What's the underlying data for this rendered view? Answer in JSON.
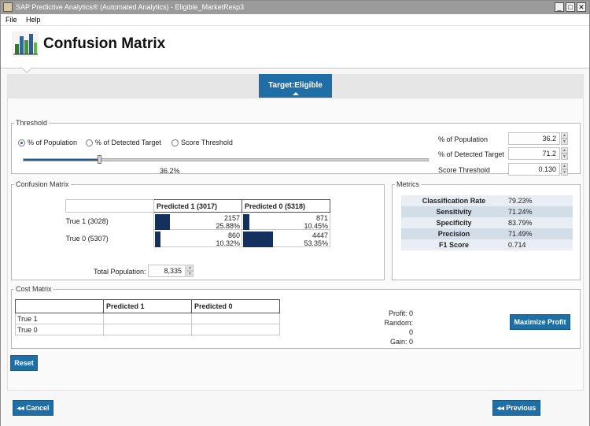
{
  "window": {
    "title": "SAP Predictive Analytics® (Automated Analytics) - Eligible_MarketResp3"
  },
  "menu": {
    "file": "File",
    "help": "Help"
  },
  "header": {
    "title": "Confusion Matrix"
  },
  "tab": {
    "label": "Target:Eligible"
  },
  "threshold": {
    "legend": "Threshold",
    "radios": [
      "% of Population",
      "% of Detected Target",
      "Score Threshold"
    ],
    "selected": 0,
    "slider": {
      "value_label": "36.2%",
      "fraction": 0.362
    },
    "fields": [
      {
        "label": "% of Population",
        "value": "36.2"
      },
      {
        "label": "% of Detected Target",
        "value": "71.2"
      },
      {
        "label": "Score Threshold",
        "value": "0.130"
      }
    ]
  },
  "confusion": {
    "legend": "Confusion Matrix",
    "col_headers": [
      "Predicted 1  (3017)",
      "Predicted 0  (5318)"
    ],
    "rows": [
      {
        "label": "True 1  (3028)",
        "cells": [
          {
            "count": "2157",
            "pct": "25.88%",
            "fraction": 0.2588
          },
          {
            "count": "871",
            "pct": "10.45%",
            "fraction": 0.1045
          }
        ]
      },
      {
        "label": "True 0  (5307)",
        "cells": [
          {
            "count": "860",
            "pct": "10.32%",
            "fraction": 0.1032
          },
          {
            "count": "4447",
            "pct": "53.35%",
            "fraction": 0.5335
          }
        ]
      }
    ],
    "total_label": "Total Population:",
    "total_value": "8,335"
  },
  "metrics": {
    "legend": "Metrics",
    "items": [
      {
        "name": "Classification Rate",
        "value": "79.23%"
      },
      {
        "name": "Sensitivity",
        "value": "71.24%"
      },
      {
        "name": "Specificity",
        "value": "83.79%"
      },
      {
        "name": "Precision",
        "value": "71.49%"
      },
      {
        "name": "F1 Score",
        "value": "0.714"
      }
    ]
  },
  "cost": {
    "legend": "Cost Matrix",
    "col_headers": [
      "Predicted 1",
      "Predicted 0"
    ],
    "rows": [
      "True 1",
      "True 0"
    ],
    "profit": "Profit: 0",
    "random": "Random: 0",
    "gain": "Gain:  0",
    "maximize_label": "Maximize Profit"
  },
  "buttons": {
    "reset": "Reset",
    "cancel": "◂◂ Cancel",
    "previous": "◂◂ Previous"
  },
  "colors": {
    "accent": "#1f6fa6",
    "bar": "#13305e"
  }
}
